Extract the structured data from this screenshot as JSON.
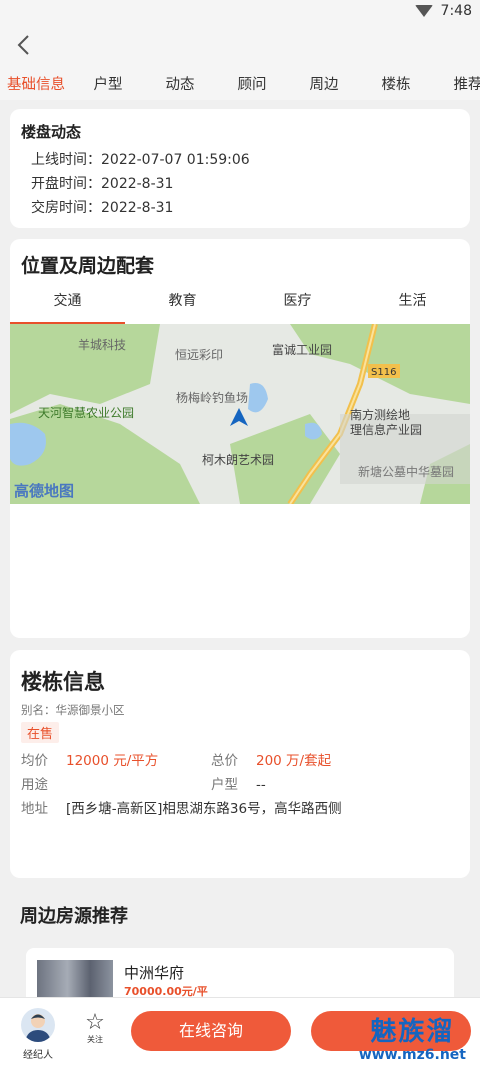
{
  "status_bar": {
    "time": "7:48"
  },
  "tabs": [
    "基础信息",
    "户型",
    "动态",
    "顾问",
    "周边",
    "楼栋",
    "推荐"
  ],
  "dynamics": {
    "title": "楼盘动态",
    "lines": [
      "上线时间：2022-07-07 01:59:06",
      "开盘时间：2022-8-31",
      "交房时间：2022-8-31"
    ]
  },
  "location": {
    "title": "位置及周边配套",
    "sub_tabs": [
      "交通",
      "教育",
      "医疗",
      "生活"
    ],
    "map_labels": [
      "羊城科技",
      "恒远彩印",
      "富诚工业园",
      "S116",
      "杨梅岭钓鱼场",
      "天河智慧农业公园",
      "南方测绘地",
      "理信息产业园",
      "柯木朗艺术园",
      "新塘公墓中华墓园",
      "高德地图"
    ]
  },
  "building": {
    "title": "楼栋信息",
    "alias": "别名：华源御景小区",
    "status": "在售",
    "avg_price_label": "均价",
    "avg_price": "12000 元/平方",
    "total_price_label": "总价",
    "total_price": "200 万/套起",
    "use_label": "用途",
    "use_value": "",
    "layout_label": "户型",
    "layout_value": "--",
    "address_label": "地址",
    "address": "[西乡塘-高新区]相思湖东路36号，高华路西侧"
  },
  "recommend": {
    "title": "周边房源推荐",
    "name": "中洲华府",
    "price": "70000.00元/平"
  },
  "bottom": {
    "agent_label": "经纪人",
    "follow_label": "关注",
    "consult_label": "在线咨询",
    "watermark_cn": "魅族溜",
    "watermark_url": "www.mz6.net"
  }
}
